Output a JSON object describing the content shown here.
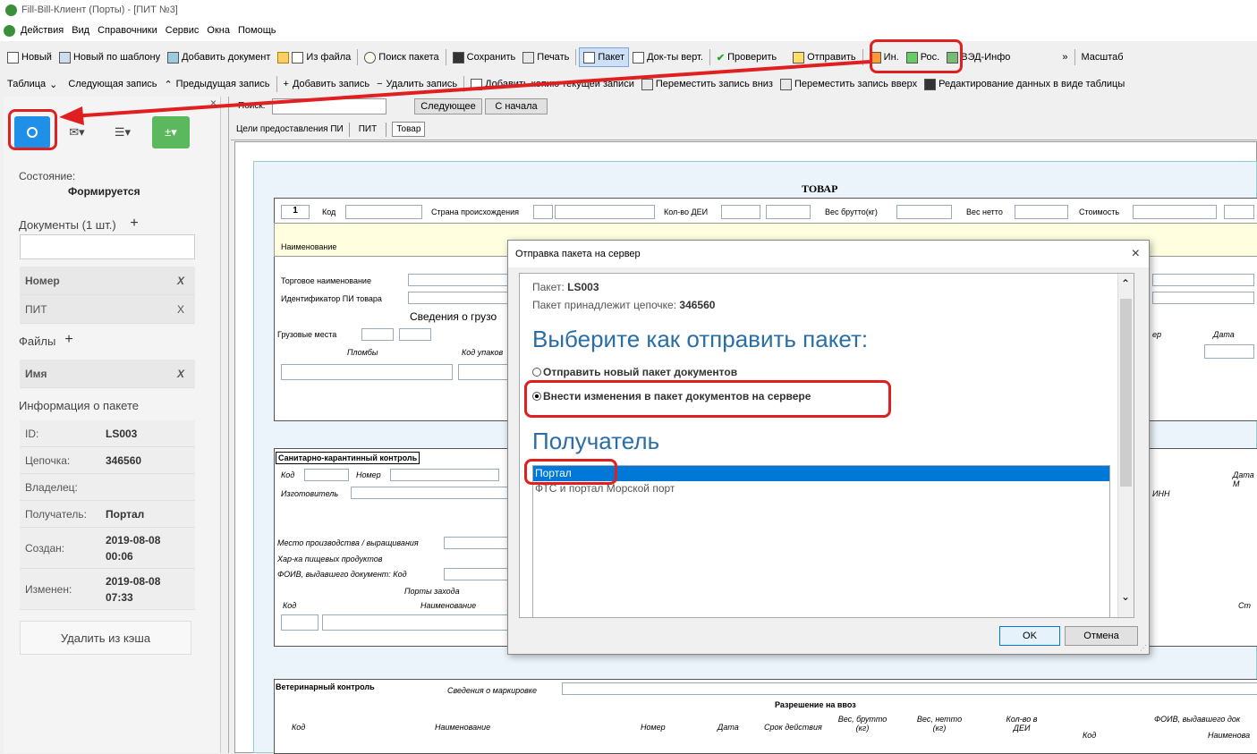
{
  "window": {
    "title": "Fill-Bill-Клиент (Порты) - [ПИТ №3]"
  },
  "menu": [
    "Действия",
    "Вид",
    "Справочники",
    "Сервис",
    "Окна",
    "Помощь"
  ],
  "toolbar1": {
    "new": "Новый",
    "new_template": "Новый по шаблону",
    "add_doc": "Добавить документ",
    "from_file": "Из файла",
    "search_packet": "Поиск пакета",
    "save": "Сохранить",
    "print": "Печать",
    "packet": "Пакет",
    "docs_vert": "Док-ты верт.",
    "check": "Проверить",
    "send": "Отправить",
    "in": "Ин.",
    "ros": "Рос.",
    "ved": "ВЭД-Инфо",
    "more": "»",
    "scale": "Масштаб"
  },
  "toolbar2": {
    "table": "Таблица",
    "next": "Следующая запись",
    "prev": "Предыдущая запись",
    "add": "Добавить запись",
    "remove": "Удалить запись",
    "add_copy": "Добавить копию текущей записи",
    "move_down": "Переместить запись вниз",
    "move_up": "Переместить запись вверх",
    "edit_table": "Редактирование данных в виде таблицы"
  },
  "left": {
    "close_glyph": "×",
    "state_label": "Состояние:",
    "state_value": "Формируется",
    "docs_label": "Документы (1 шт.)",
    "docs_header": "Номер",
    "docs_row": "ПИТ",
    "x": "X",
    "files_label": "Файлы",
    "files_header": "Имя",
    "info_label": "Информация о пакете",
    "info": [
      {
        "k": "ID:",
        "v": "LS003"
      },
      {
        "k": "Цепочка:",
        "v": "346560"
      },
      {
        "k": "Владелец:",
        "v": ""
      },
      {
        "k": "Получатель:",
        "v": "Портал"
      },
      {
        "k": "Создан:",
        "v": "2019-08-08 00:06"
      },
      {
        "k": "Изменен:",
        "v": "2019-08-08 07:33"
      }
    ],
    "delete_cache": "Удалить из кэша"
  },
  "search": {
    "label": "Поиск:",
    "next": "Следующее",
    "from_start": "С начала"
  },
  "tabs": [
    "Цели предоставления ПИ",
    "ПИТ",
    "Товар"
  ],
  "form": {
    "title": "ТОВАР",
    "num": "1",
    "code": "Код",
    "country": "Страна происхождения",
    "qty": "Кол-во ДЕИ",
    "gross": "Вес брутто(кг)",
    "net": "Вес нетто",
    "cost": "Стоимость",
    "name": "Наименование",
    "trade_name": "Торговое наименование",
    "id_pi": "Идентификатор ПИ товара",
    "cargo_info": "Сведения о грузо",
    "cargo_places": "Грузовые места",
    "seals": "Пломбы",
    "pack_code": "Код упаков",
    "right_p": "ер",
    "date": "Дата",
    "sanitary": "Санитарно-карантинный контроль",
    "code2": "Код",
    "number": "Номер",
    "date_m": "Дата М",
    "maker": "Изготовитель",
    "inn": "ИНН",
    "place": "Место производства / выращивания",
    "food": "Хар-ка пищевых продуктов",
    "foiv": "ФОИВ, выдавшего документ: Код",
    "ports": "Порты захода",
    "code3": "Код",
    "name2": "Наименование",
    "st": "Ст",
    "vet": "Ветеринарный контроль",
    "marking": "Сведения о маркировке",
    "permit": "Разрешение на ввоз",
    "c_code": "Код",
    "c_name": "Наименование",
    "c_number": "Номер",
    "c_date": "Дата",
    "c_term": "Срок действия",
    "c_gross": "Вес, брутто (кг)",
    "c_net": "Вес, нетто (кг)",
    "c_qty": "Кол-во в ДЕИ",
    "c_foiv": "ФОИВ, выдавшего док",
    "c_code2": "Код",
    "c_name3": "Наименова"
  },
  "dialog": {
    "title": "Отправка пакета на сервер",
    "close": "×",
    "packet_label": "Пакет:",
    "packet_value": "LS003",
    "chain_label": "Пакет принадлежит цепочке:",
    "chain_value": "346560",
    "heading_send": "Выберите как отправить пакет:",
    "opt_new": "Отправить новый пакет документов",
    "opt_modify": "Внести изменения в пакет документов на сервере",
    "heading_recipient": "Получатель",
    "recipients": [
      "Портал",
      "ФТС и портал Морской порт"
    ],
    "ok": "OK",
    "cancel": "Отмена"
  },
  "colors": {
    "accent": "#0078d7",
    "annotation": "#e02020",
    "green": "#5cb85c"
  }
}
